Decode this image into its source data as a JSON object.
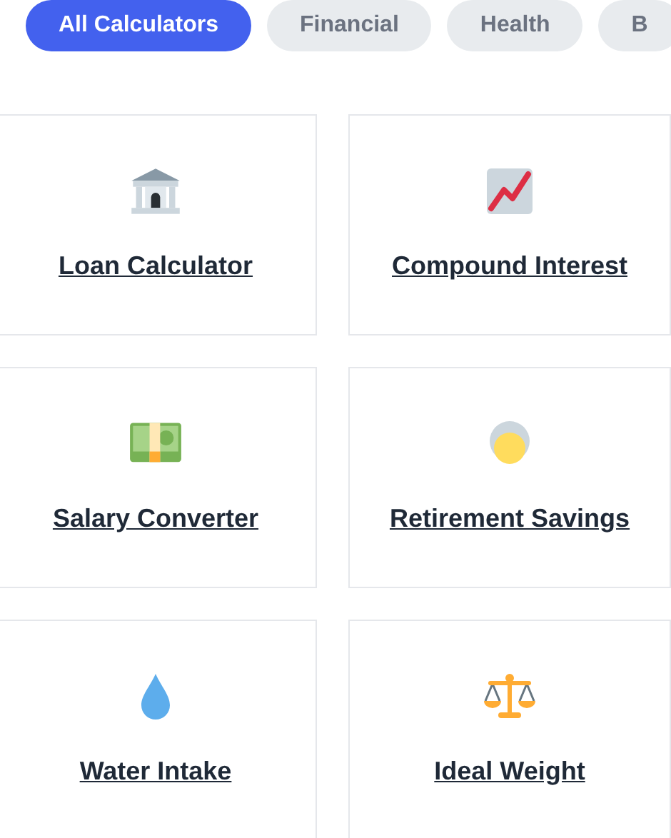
{
  "filters": [
    {
      "label": "All Calculators",
      "selected": true
    },
    {
      "label": "Financial",
      "selected": false
    },
    {
      "label": "Health",
      "selected": false
    },
    {
      "label": "B",
      "selected": false
    }
  ],
  "calculators": [
    {
      "title": "Loan Calculator"
    },
    {
      "title": "Compound Interest"
    },
    {
      "title": "Salary Converter"
    },
    {
      "title": "Retirement Savings"
    },
    {
      "title": "Water Intake"
    },
    {
      "title": "Ideal Weight"
    }
  ]
}
